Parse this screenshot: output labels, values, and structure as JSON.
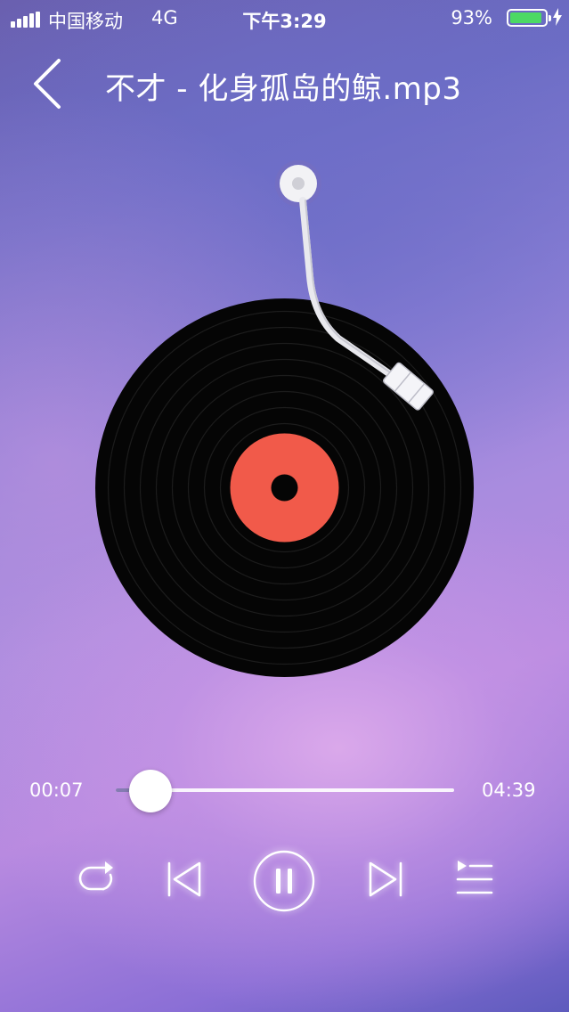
{
  "status_bar": {
    "carrier": "中国移动",
    "network": "4G",
    "time": "下午3:29",
    "battery_percent": "93%",
    "battery_level": 0.93,
    "signal_icon": "signal-bars-icon",
    "battery_icon": "battery-icon",
    "charging_icon": "charging-bolt-icon"
  },
  "header": {
    "back_icon": "chevron-left-icon",
    "title": "不才 - 化身孤岛的鲸.mp3"
  },
  "player": {
    "elapsed": "00:07",
    "duration": "04:39",
    "progress": 0.025,
    "state": "playing"
  },
  "controls": {
    "repeat_icon": "repeat-icon",
    "previous_icon": "skip-previous-icon",
    "pause_icon": "pause-icon",
    "next_icon": "skip-next-icon",
    "playlist_icon": "playlist-icon"
  },
  "colors": {
    "record_label": "#f15a4a",
    "record_vinyl": "#050505",
    "battery_fill": "#4cd964",
    "foreground": "#ffffff"
  }
}
